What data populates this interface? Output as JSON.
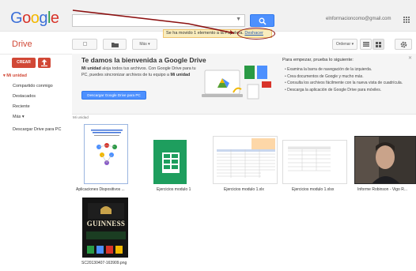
{
  "app": {
    "logo_letters": [
      "G",
      "o",
      "o",
      "g",
      "l",
      "e"
    ],
    "product": "Drive",
    "account": "elnformacioncomo@gmail.com",
    "accent": "#d14836",
    "primary": "#4d90fe"
  },
  "toolbar": {
    "more_label": "Más",
    "sort_label": "Ordenar",
    "notice_text": "Se ha movido 1 elemento a la Papelera.",
    "notice_link": "Deshacer"
  },
  "sidebar": {
    "create_label": "CREAR",
    "items": [
      {
        "label": "▾ Mi unidad",
        "active": true
      },
      {
        "label": "Compartido conmigo"
      },
      {
        "label": "Destacados"
      },
      {
        "label": "Reciente"
      },
      {
        "label": "Más ▾"
      },
      {
        "label": "Descargar Drive para PC"
      }
    ]
  },
  "welcome": {
    "title": "Te damos la bienvenida a Google Drive",
    "text_bold": "Mi unidad",
    "text_middle": " aloja todos tus archivos. Con Google Drive para tu PC, puedes sincronizar archivos de tu equipo a ",
    "text_bold2": "Mi unidad",
    "button": "Descargar Google Drive para PC",
    "tips_title": "Para empezar, prueba lo siguiente:",
    "tips": [
      "Examina la barra de navegación de la izquierda.",
      "Crea documentos de Google y mucho más.",
      "Consulta los archivos fácilmente con la nueva vista de cuadrícula.",
      "Descarga la aplicación de Google Drive para móviles."
    ]
  },
  "section_label": "Mi unidad",
  "files": [
    {
      "name": "Aplicaciones Dispositivos ...",
      "kind": "doc"
    },
    {
      "name": "Ejercicios modulo 1",
      "kind": "sheet"
    },
    {
      "name": "Ejercicios modulo 1.xlx",
      "kind": "xls"
    },
    {
      "name": "Ejercicios modulo 1.xlsx",
      "kind": "xlsx"
    },
    {
      "name": "Informe Robinson - Vigo R...",
      "kind": "video"
    },
    {
      "name": "SC20130407-163909.png",
      "kind": "image",
      "image_text": "GUINNESS"
    }
  ]
}
